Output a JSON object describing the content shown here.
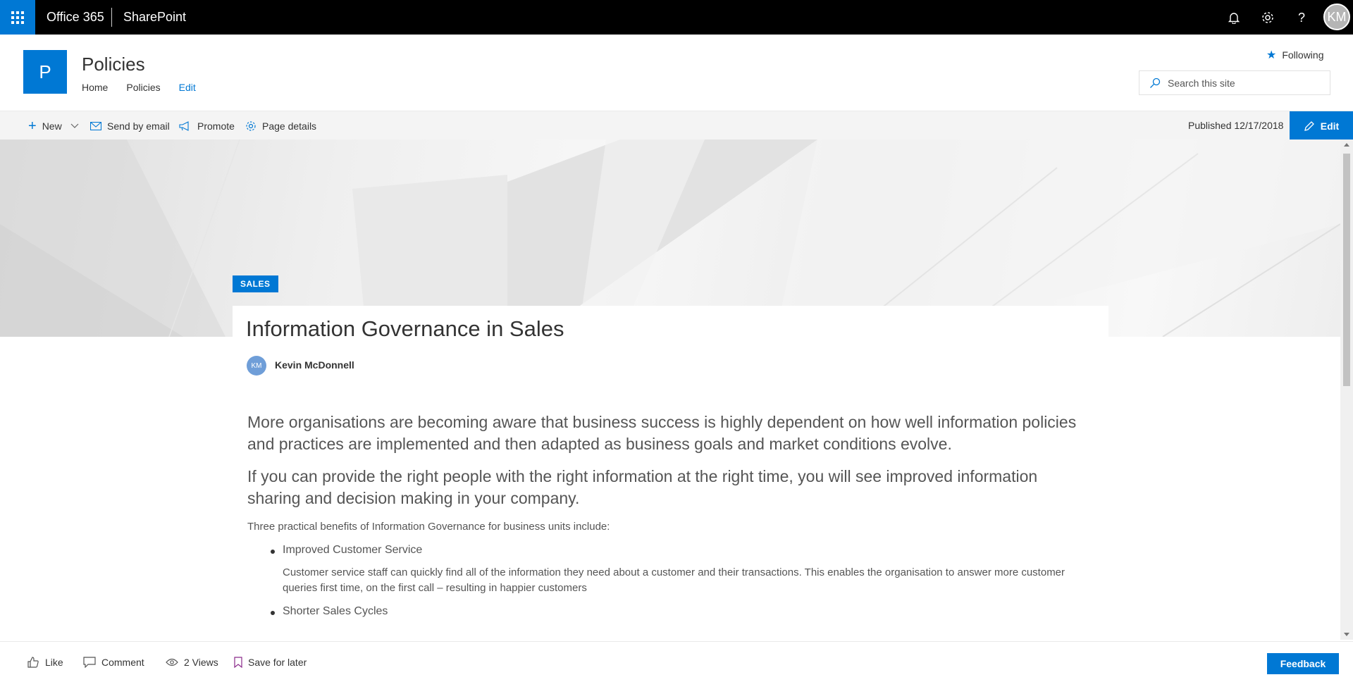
{
  "suite": {
    "brand": "Office 365",
    "app": "SharePoint",
    "user_initials": "KM",
    "icons": [
      "app-launcher-icon",
      "bell-icon",
      "gear-icon",
      "help-icon"
    ]
  },
  "site": {
    "logo_letter": "P",
    "title": "Policies",
    "nav": [
      "Home",
      "Policies",
      "Edit"
    ],
    "following_label": "Following",
    "search_placeholder": "Search this site"
  },
  "commands": {
    "new": "New",
    "send_email": "Send by email",
    "promote": "Promote",
    "page_details": "Page details",
    "published": "Published 12/17/2018",
    "edit": "Edit"
  },
  "article": {
    "category": "SALES",
    "title": "Information Governance in Sales",
    "author_initials": "KM",
    "author_name": "Kevin McDonnell",
    "lead1": "More organisations are becoming aware that business success is highly dependent on how well information policies and practices are implemented and then adapted as business goals and market conditions evolve.",
    "lead2": "If you can provide the right people with the right information at the right time, you will see improved information sharing and decision making in your company.",
    "intro": "Three practical benefits of Information Governance for business units include:",
    "bullets": [
      {
        "title": "Improved Customer Service",
        "desc": "Customer service staff can quickly find all of the information they need about a customer and their transactions. This enables the organisation to answer more customer queries first time, on the first call – resulting in happier customers"
      },
      {
        "title": "Shorter Sales Cycles",
        "desc": ""
      }
    ]
  },
  "footer": {
    "like": "Like",
    "comment": "Comment",
    "views": "2 Views",
    "save": "Save for later",
    "feedback": "Feedback"
  },
  "colors": {
    "accent": "#0078d4",
    "suite_bar": "#000000",
    "command_bar": "#f4f4f4"
  }
}
